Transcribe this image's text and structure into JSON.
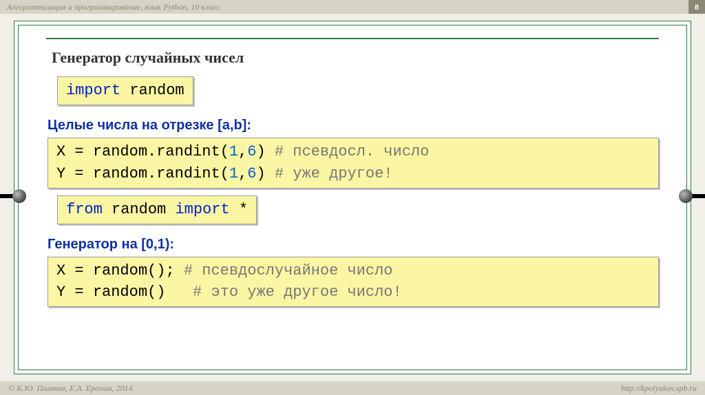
{
  "header": {
    "course": "Алгоритмизация и программирование, язык Python, 10 класс",
    "page": "8"
  },
  "footer": {
    "left": "© К.Ю. Поляков, Е.А. Еремин, 2014",
    "right": "http://kpolyakov.spb.ru"
  },
  "title": "Генератор случайных чисел",
  "box1": {
    "kw1": "import",
    "sp": " ",
    "mod": "random"
  },
  "sub1": "Целые числа на отрезке [a,b]:",
  "box2": {
    "l1a": "X = ",
    "l1b": "random.randint(",
    "l1c": "1",
    "l1d": ",",
    "l1e": "6",
    "l1f": ") ",
    "l1g": "# псевдосл. число",
    "l2a": "Y = ",
    "l2b": "random.randint(",
    "l2c": "1",
    "l2d": ",",
    "l2e": "6",
    "l2f": ") ",
    "l2g": "# уже другое!"
  },
  "box3": {
    "kw1": "from",
    "sp1": " ",
    "mod": "random",
    "sp2": " ",
    "kw2": "import",
    "sp3": " ",
    "star": "*"
  },
  "sub2": "Генератор на [0,1):",
  "box4": {
    "l1a": "X = ",
    "l1b": "random()",
    "l1c": "; ",
    "l1g": "# псевдослучайное число",
    "l2a": "Y = ",
    "l2b": "random()",
    "l2c": "   ",
    "l2g": "# это уже другое число!"
  }
}
